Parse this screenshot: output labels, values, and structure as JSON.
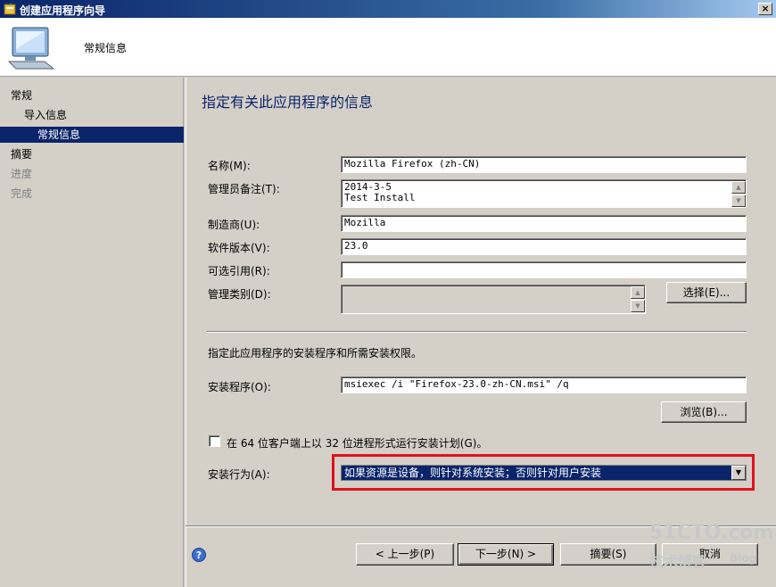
{
  "window": {
    "title": "创建应用程序向导",
    "close": "×"
  },
  "header": {
    "title": "常规信息"
  },
  "sidebar": {
    "items": [
      {
        "label": "常规"
      },
      {
        "label": "导入信息"
      },
      {
        "label": "常规信息"
      },
      {
        "label": "摘要"
      },
      {
        "label": "进度"
      },
      {
        "label": "完成"
      }
    ]
  },
  "main": {
    "page_title": "指定有关此应用程序的信息",
    "fields": {
      "name_label": "名称(M):",
      "name_value": "Mozilla Firefox (zh-CN)",
      "admin_comment_label": "管理员备注(T):",
      "admin_comment_value": "2014-3-5\nTest Install",
      "publisher_label": "制造商(U):",
      "publisher_value": "Mozilla",
      "version_label": "软件版本(V):",
      "version_value": "23.0",
      "reference_label": "可选引用(R):",
      "reference_value": "",
      "category_label": "管理类别(D):",
      "category_value": "",
      "select_button": "选择(E)..."
    },
    "install_section_text": "指定此应用程序的安装程序和所需安装权限。",
    "installer_label": "安装程序(O):",
    "installer_value": "msiexec /i \"Firefox-23.0-zh-CN.msi\" /q",
    "browse_button": "浏览(B)...",
    "checkbox_label": "在 64 位客户端上以 32 位进程形式运行安装计划(G)。",
    "checkbox_checked": false,
    "behavior_label": "安装行为(A):",
    "behavior_value": "如果资源是设备，则针对系统安装；否则针对用户安装"
  },
  "footer": {
    "prev_button": "< 上一步(P)",
    "next_button": "下一步(N) >",
    "summary_button": "摘要(S)",
    "cancel_button": "取消"
  },
  "watermark": {
    "line1": "51CTO.com",
    "line2": "技术博客",
    "line3": "Blog"
  }
}
